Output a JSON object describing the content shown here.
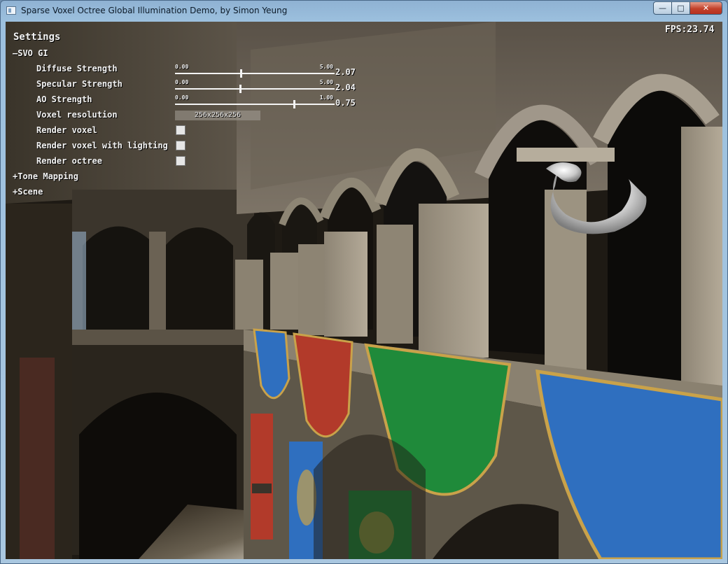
{
  "window": {
    "title": "Sparse Voxel Octree Global Illumination Demo, by Simon Yeung",
    "buttons": {
      "minimize": "—",
      "maximize": "□",
      "close": "✕"
    }
  },
  "hud": {
    "fps": "FPS:23.74",
    "settings_title": "Settings",
    "groups": {
      "svo_gi": {
        "label": "—SVO GI",
        "expanded": true
      },
      "tone_mapping": {
        "label": "+Tone Mapping",
        "expanded": false
      },
      "scene": {
        "label": "+Scene",
        "expanded": false
      }
    },
    "diffuse": {
      "label": "Diffuse Strength",
      "min": "0.00",
      "max": "5.00",
      "value": "2.07",
      "fraction": 0.414
    },
    "specular": {
      "label": "Specular Strength",
      "min": "0.00",
      "max": "5.00",
      "value": "2.04",
      "fraction": 0.408
    },
    "ao": {
      "label": "AO Strength",
      "min": "0.00",
      "max": "1.00",
      "value": "0.75",
      "fraction": 0.75
    },
    "voxel_res": {
      "label": "Voxel resolution",
      "value": "256x256x256"
    },
    "render_voxel": {
      "label": "Render voxel",
      "checked": false
    },
    "render_voxel_lighting": {
      "label": "Render voxel with lighting",
      "checked": false
    },
    "render_octree": {
      "label": "Render octree",
      "checked": false
    }
  },
  "colors": {
    "banner_blue": "#2f6fbf",
    "banner_red": "#b23a2a",
    "banner_green": "#1f8a3a",
    "trim_gold": "#c9a24a",
    "stone": "#8a8070"
  }
}
